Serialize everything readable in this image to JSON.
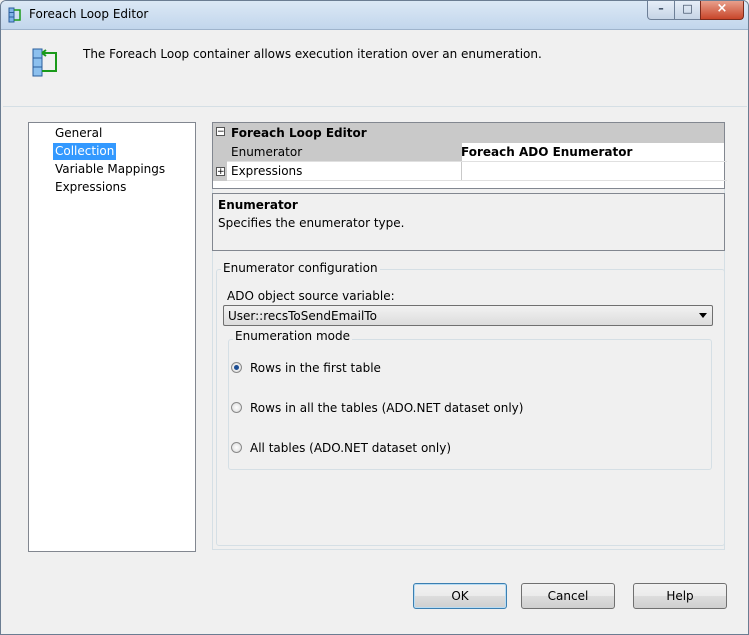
{
  "window": {
    "title": "Foreach Loop Editor",
    "controls": {
      "minimize": "–",
      "maximize": "□",
      "close": "×"
    }
  },
  "header": {
    "text": "The Foreach Loop container allows execution iteration over an enumeration."
  },
  "nav": {
    "items": [
      {
        "label": "General",
        "selected": false
      },
      {
        "label": "Collection",
        "selected": true
      },
      {
        "label": "Variable Mappings",
        "selected": false
      },
      {
        "label": "Expressions",
        "selected": false
      }
    ]
  },
  "property_grid": {
    "category": "Foreach Loop Editor",
    "category_expander": "⊟",
    "rows": [
      {
        "name": "Enumerator",
        "value": "Foreach ADO Enumerator"
      },
      {
        "name": "Expressions",
        "value": "",
        "expander": "+"
      }
    ]
  },
  "description": {
    "title": "Enumerator",
    "text": "Specifies the enumerator type."
  },
  "config": {
    "group_title": "Enumerator configuration",
    "source_label": "ADO object source variable:",
    "source_value": "User::recsToSendEmailTo",
    "mode_title": "Enumeration mode",
    "modes": [
      {
        "label": "Rows in the first table",
        "checked": true
      },
      {
        "label": "Rows in all the tables (ADO.NET dataset only)",
        "checked": false
      },
      {
        "label": "All tables (ADO.NET dataset only)",
        "checked": false
      }
    ]
  },
  "buttons": {
    "ok": "OK",
    "cancel": "Cancel",
    "help": "Help"
  },
  "colors": {
    "selection": "#3399ff",
    "grid_category": "#c9c9c9",
    "window_bg": "#f0f0f0",
    "close_button": "#c8462a"
  }
}
